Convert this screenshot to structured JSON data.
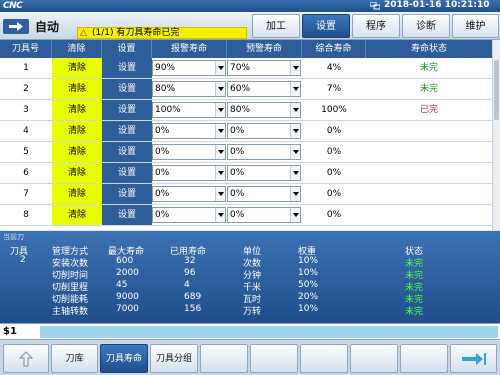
{
  "header": {
    "logo": "CNC",
    "datetime": "2018-01-16 10:21:10"
  },
  "title": {
    "mode": "自动",
    "alarm_symbol": "△",
    "alarm": "(1/1) 有刀具寿命已完"
  },
  "top_buttons": [
    {
      "label": "加工",
      "active": false
    },
    {
      "label": "设置",
      "active": true
    },
    {
      "label": "程序",
      "active": false
    },
    {
      "label": "诊断",
      "active": false
    },
    {
      "label": "维护",
      "active": false
    }
  ],
  "table": {
    "headers": [
      "刀具号",
      "清除",
      "设置",
      "报警寿命",
      "预警寿命",
      "综合寿命",
      "寿命状态"
    ],
    "rows": [
      {
        "no": "1",
        "clear": "清除",
        "set": "设置",
        "alarm": "90%",
        "warn": "70%",
        "life": "4%",
        "status": "未完"
      },
      {
        "no": "2",
        "clear": "清除",
        "set": "设置",
        "alarm": "80%",
        "warn": "60%",
        "life": "7%",
        "status": "未完"
      },
      {
        "no": "3",
        "clear": "清除",
        "set": "设置",
        "alarm": "100%",
        "warn": "80%",
        "life": "100%",
        "status": "已完"
      },
      {
        "no": "4",
        "clear": "清除",
        "set": "设置",
        "alarm": "0%",
        "warn": "0%",
        "life": "0%",
        "status": ""
      },
      {
        "no": "5",
        "clear": "清除",
        "set": "设置",
        "alarm": "0%",
        "warn": "0%",
        "life": "0%",
        "status": ""
      },
      {
        "no": "6",
        "clear": "清除",
        "set": "设置",
        "alarm": "0%",
        "warn": "0%",
        "life": "0%",
        "status": ""
      },
      {
        "no": "7",
        "clear": "清除",
        "set": "设置",
        "alarm": "0%",
        "warn": "0%",
        "life": "0%",
        "status": ""
      },
      {
        "no": "8",
        "clear": "清除",
        "set": "设置",
        "alarm": "0%",
        "warn": "0%",
        "life": "0%",
        "status": ""
      }
    ]
  },
  "current_tool": {
    "title": "当前刀",
    "tool_header": "刀具",
    "tool_value": "2",
    "headers": [
      "管理方式",
      "最大寿命",
      "已用寿命",
      "单位",
      "权重",
      "状态"
    ],
    "rows": [
      {
        "mode": "安装次数",
        "max": "600",
        "used": "32",
        "unit": "次数",
        "weight": "10%",
        "status": "未完"
      },
      {
        "mode": "切削时间",
        "max": "2000",
        "used": "96",
        "unit": "分钟",
        "weight": "10%",
        "status": "未完"
      },
      {
        "mode": "切削里程",
        "max": "45",
        "used": "4",
        "unit": "千米",
        "weight": "50%",
        "status": "未完"
      },
      {
        "mode": "切削能耗",
        "max": "9000",
        "used": "689",
        "unit": "瓦时",
        "weight": "20%",
        "status": "未完"
      },
      {
        "mode": "主轴转数",
        "max": "7000",
        "used": "156",
        "unit": "万转",
        "weight": "10%",
        "status": "未完"
      }
    ]
  },
  "command": {
    "label": "$1",
    "value": ""
  },
  "softkeys": [
    {
      "label": "",
      "icon": "up-arrow-icon",
      "active": false
    },
    {
      "label": "刀库",
      "active": false
    },
    {
      "label": "刀具寿命",
      "active": true
    },
    {
      "label": "刀具分组",
      "active": false
    },
    {
      "label": "",
      "active": false
    },
    {
      "label": "",
      "active": false
    },
    {
      "label": "",
      "active": false
    },
    {
      "label": "",
      "active": false
    },
    {
      "label": "",
      "active": false
    },
    {
      "label": "",
      "icon": "next-arrow-icon",
      "active": false
    }
  ],
  "colors": {
    "accent": "#2e5e9a",
    "clear_bg": "#e8ff00",
    "alarm_bg": "#f4f000",
    "done_red": "#d02020",
    "ok_green": "#0a9a2a"
  }
}
